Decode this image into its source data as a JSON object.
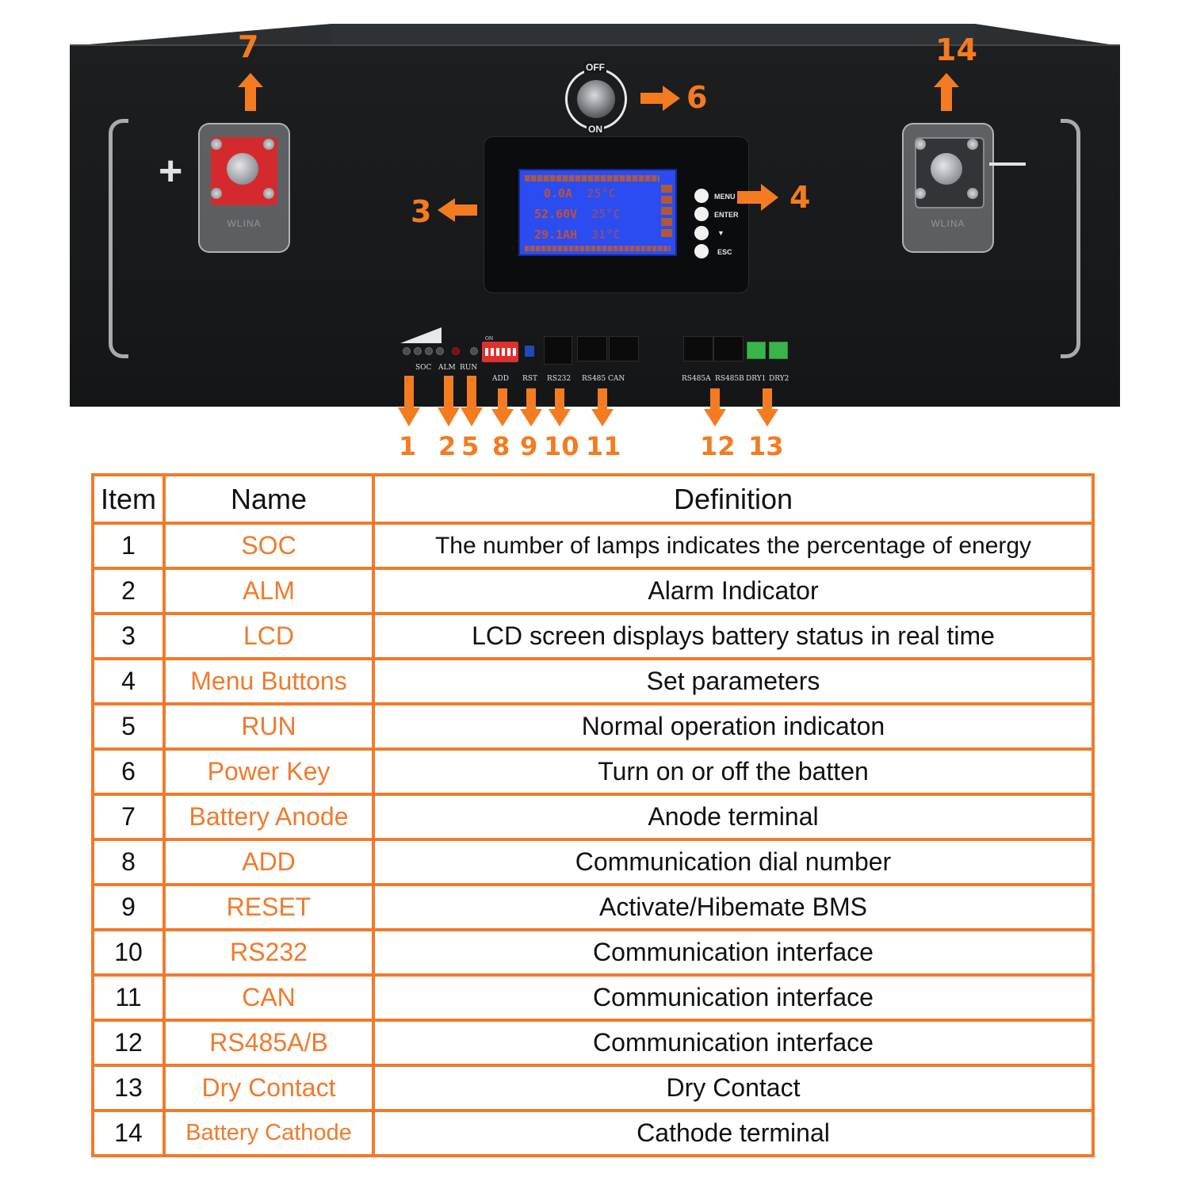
{
  "device": {
    "polarity": {
      "positive": "+",
      "negative": "−"
    },
    "terminal_brand": "WLINA",
    "power_key": {
      "off_label": "OFF",
      "on_label": "ON"
    },
    "lcd": {
      "rows": [
        {
          "value": "0.0A",
          "temp": "25°C"
        },
        {
          "value": "52.60V",
          "temp": "25°C"
        },
        {
          "value": "29.1AH",
          "temp": "31°C"
        }
      ]
    },
    "menu_buttons": [
      "MENU",
      "ENTER",
      "▼",
      "ESC"
    ],
    "port_labels": {
      "soc": "SOC",
      "alm": "ALM",
      "run": "RUN",
      "add": "ADD",
      "rst": "RST",
      "rs232": "RS232",
      "rs485_can": "RS485 CAN",
      "rs485a": "RS485A",
      "rs485b": "RS485B",
      "dry1": "DRY1",
      "dry2": "DRY2",
      "dip_on": "ON"
    }
  },
  "callouts": {
    "top": [
      "7",
      "14",
      "6",
      "3",
      "4"
    ],
    "bottom": [
      "1",
      "2",
      "5",
      "8",
      "9",
      "10",
      "11",
      "12",
      "13"
    ]
  },
  "colors": {
    "accent": "#f47b20",
    "table_border": "#f07a2c",
    "lcd_bg": "#2a4cf0"
  },
  "table": {
    "headers": [
      "Item",
      "Name",
      "Definition"
    ],
    "rows": [
      {
        "item": "1",
        "name": "SOC",
        "definition": "The number of lamps indicates the percentage of energy"
      },
      {
        "item": "2",
        "name": "ALM",
        "definition": "Alarm Indicator"
      },
      {
        "item": "3",
        "name": "LCD",
        "definition": "LCD screen displays battery status in real  time"
      },
      {
        "item": "4",
        "name": "Menu Buttons",
        "definition": "Set parameters"
      },
      {
        "item": "5",
        "name": "RUN",
        "definition": "Normal operation indicaton"
      },
      {
        "item": "6",
        "name": "Power Key",
        "definition": "Turn on or off the batten"
      },
      {
        "item": "7",
        "name": "Battery Anode",
        "definition": "Anode terminal"
      },
      {
        "item": "8",
        "name": "ADD",
        "definition": "Communication dial number"
      },
      {
        "item": "9",
        "name": "RESET",
        "definition": "Activate/Hibemate BMS"
      },
      {
        "item": "10",
        "name": "RS232",
        "definition": "Communication interface"
      },
      {
        "item": "11",
        "name": "CAN",
        "definition": "Communication interface"
      },
      {
        "item": "12",
        "name": "RS485A/B",
        "definition": "Communication interface"
      },
      {
        "item": "13",
        "name": "Dry Contact",
        "definition": "Dry Contact"
      },
      {
        "item": "14",
        "name": "Battery Cathode",
        "definition": "Cathode terminal"
      }
    ]
  }
}
